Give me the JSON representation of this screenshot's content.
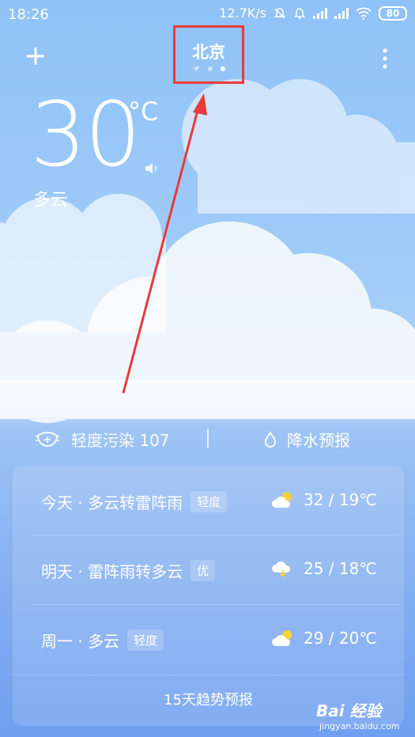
{
  "status_bar": {
    "time": "18:26",
    "speed": "12.7K/s",
    "battery": "80"
  },
  "header": {
    "city": "北京"
  },
  "current": {
    "temperature": "30",
    "unit": "°C",
    "condition": "多云"
  },
  "info": {
    "aqi_label": "轻度污染 107",
    "rain_label": "降水预报"
  },
  "forecast": [
    {
      "day": "今天 · 多云转雷阵雨",
      "quality": "轻度",
      "icon": "partly-cloudy-icon",
      "temps": "32 / 19℃"
    },
    {
      "day": "明天 · 雷阵雨转多云",
      "quality": "优",
      "icon": "thunderstorm-icon",
      "temps": "25 / 18℃"
    },
    {
      "day": "周一 · 多云",
      "quality": "轻度",
      "icon": "partly-cloudy-icon",
      "temps": "29 / 20℃"
    }
  ],
  "trend_label": "15天趋势预报",
  "watermark": {
    "brand": "Bai 经验",
    "url": "jingyan.baidu.com"
  },
  "colors": {
    "annotation_red": "#e83a3a"
  }
}
